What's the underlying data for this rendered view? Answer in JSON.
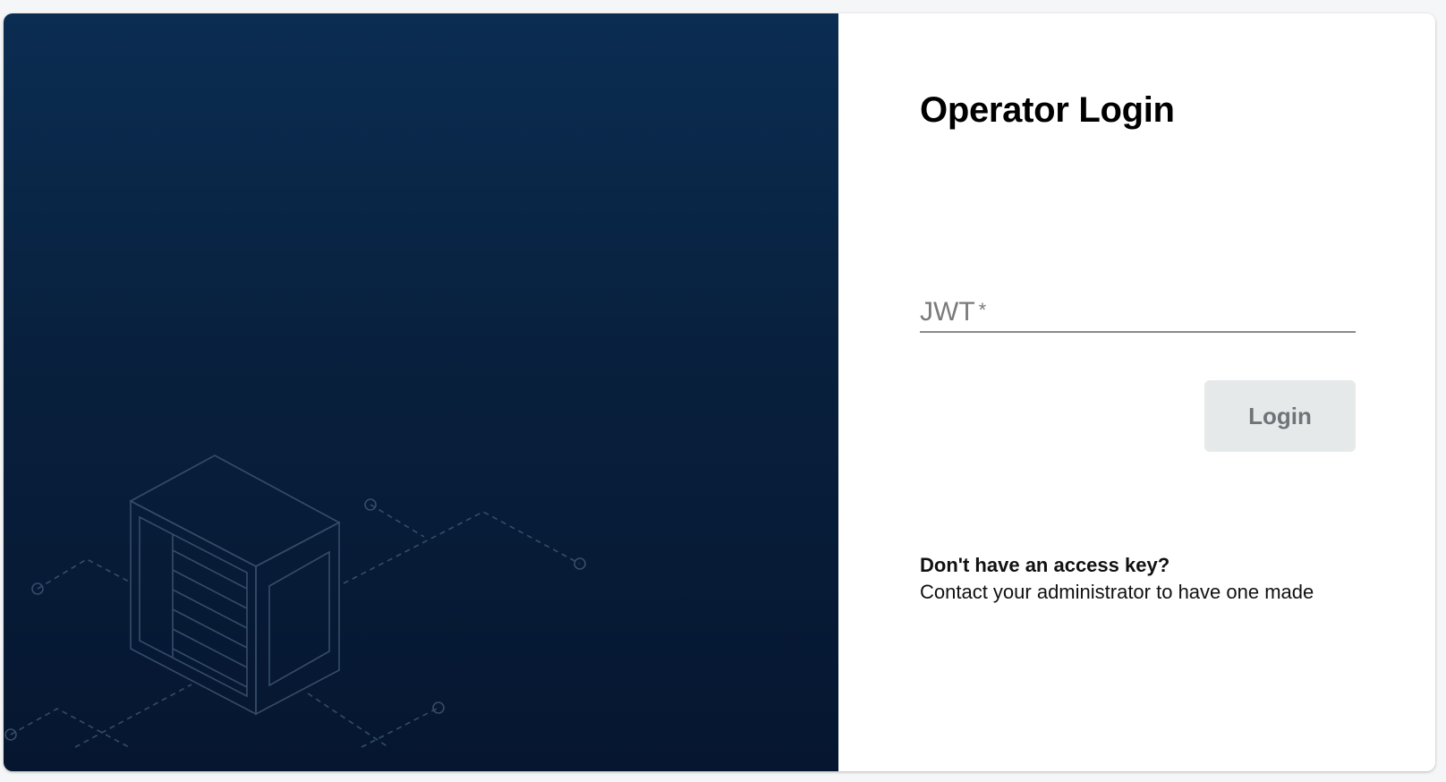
{
  "login": {
    "title": "Operator Login",
    "jwt_label": "JWT",
    "jwt_required_mark": "*",
    "jwt_value": "",
    "login_button": "Login",
    "help_question": "Don't have an access key?",
    "help_answer": "Contact your administrator to have one made"
  },
  "colors": {
    "panel_top": "#0b2d52",
    "panel_bottom": "#061630",
    "button_bg": "#e6e9ea",
    "button_text": "#6f7478"
  },
  "illustration": {
    "icon": "server-rack-illustration"
  }
}
